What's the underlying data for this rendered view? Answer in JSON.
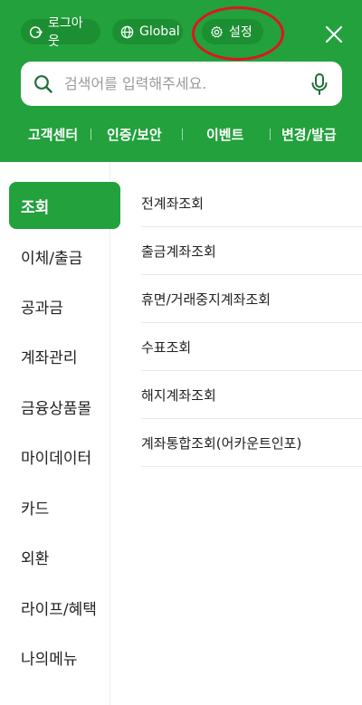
{
  "header": {
    "logout_label": "로그아웃",
    "global_label": "Global",
    "settings_label": "설정",
    "search_placeholder": "검색어를 입력해주세요.",
    "quick_links": [
      "고객센터",
      "인증/보안",
      "이벤트",
      "변경/발급"
    ]
  },
  "sidebar": {
    "items": [
      {
        "label": "조회",
        "active": true
      },
      {
        "label": "이체/출금"
      },
      {
        "label": "공과금"
      },
      {
        "label": "계좌관리"
      },
      {
        "label": "금융상품몰"
      },
      {
        "label": "마이데이터"
      },
      {
        "label": "카드"
      },
      {
        "label": "외환"
      },
      {
        "label": "라이프/혜택"
      },
      {
        "label": "나의메뉴"
      }
    ]
  },
  "content": {
    "items": [
      "전계좌조회",
      "출금계좌조회",
      "휴면/거래중지계좌조회",
      "수표조회",
      "해지계좌조회",
      "계좌통합조회(어카운트인포)"
    ]
  },
  "colors": {
    "brand_green": "#22a13c",
    "pill_green": "#1c8f33",
    "highlight_red": "#e0141f"
  }
}
